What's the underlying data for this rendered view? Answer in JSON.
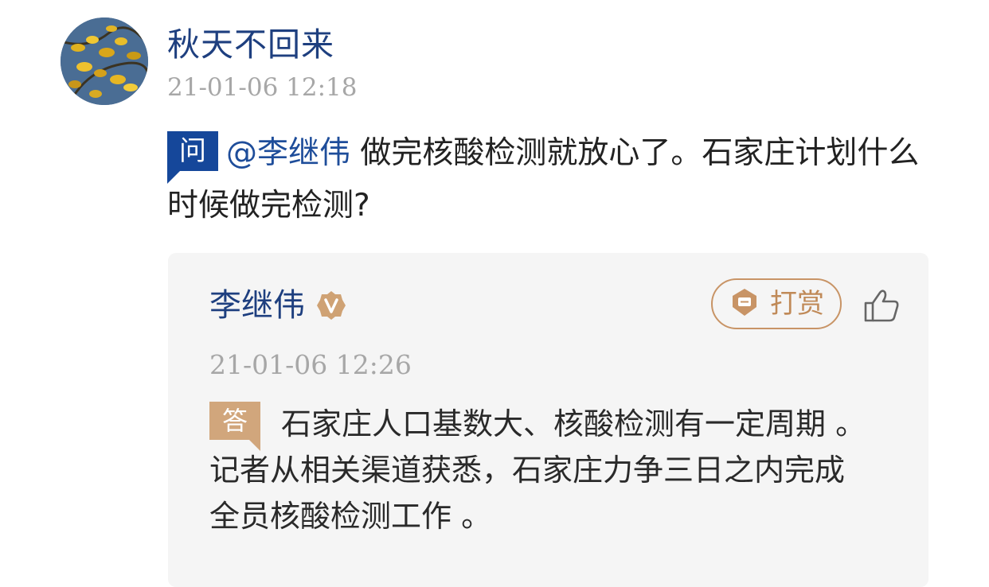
{
  "question_post": {
    "username": "秋天不回来",
    "timestamp": "21-01-06 12:18",
    "badge_label": "问",
    "mention": "@李继伟",
    "text": "做完核酸检测就放心了。石家庄计划什么时候做完检测?"
  },
  "answer_post": {
    "answerer_name": "李继伟",
    "verified_icon": "verified-v-badge",
    "tip_button_label": "打赏",
    "tip_icon": "tip-gem-icon",
    "like_icon": "thumbs-up-icon",
    "timestamp": "21-01-06 12:26",
    "badge_label": "答",
    "text": "石家庄人口基数大、核酸检测有一定周期 。记者从相关渠道获悉，石家庄力争三日之内完成全员核酸检测工作 。"
  },
  "colors": {
    "name_blue": "#1e3f7f",
    "question_badge": "#15479a",
    "answer_badge": "#d1a67c",
    "tip_accent": "#c89466",
    "timestamp_gray": "#a7a7a7",
    "card_background": "#f5f5f5"
  }
}
